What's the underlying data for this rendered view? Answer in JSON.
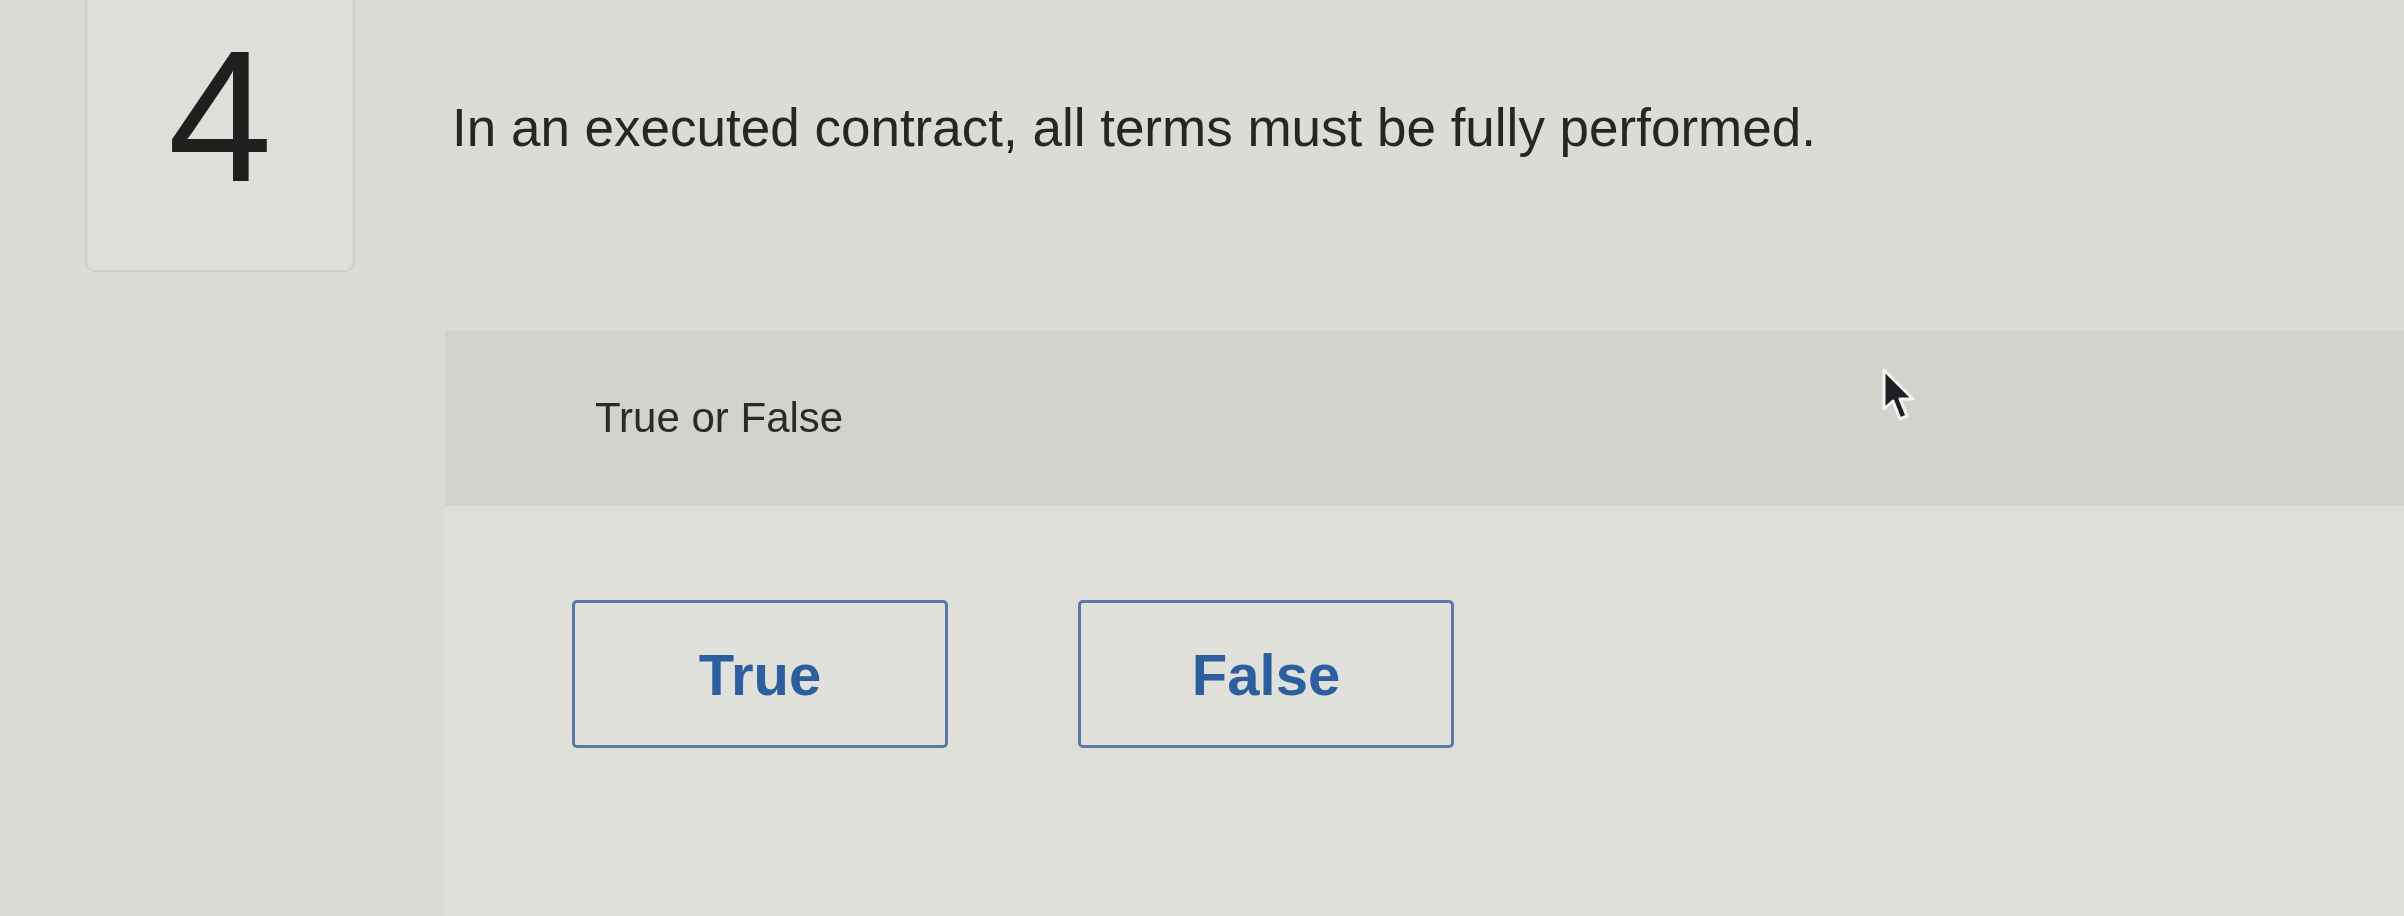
{
  "question": {
    "number": "4",
    "text": "In an executed contract, all terms must be fully performed."
  },
  "answer_panel": {
    "type_label": "True or False",
    "options": [
      {
        "label": "True",
        "selected": false
      },
      {
        "label": "False",
        "selected": false
      }
    ]
  }
}
